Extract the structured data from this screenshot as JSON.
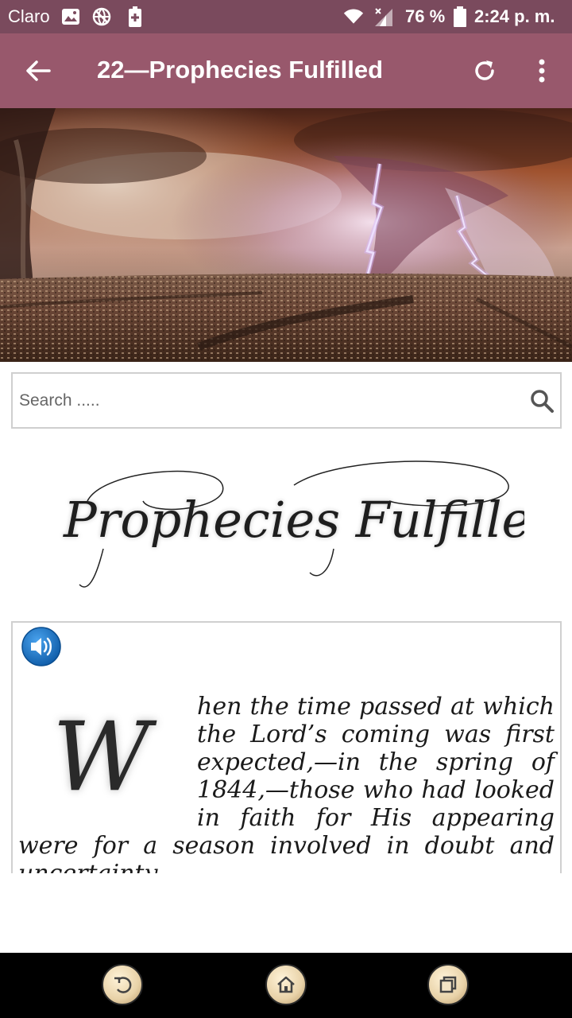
{
  "status_bar": {
    "carrier": "Claro",
    "battery_percent": "76 %",
    "time": "2:24 p. m.",
    "icons": [
      "image-icon",
      "vpn-globe-icon",
      "battery-saver-icon",
      "wifi-icon",
      "signal-icon",
      "battery-icon"
    ]
  },
  "app_bar": {
    "title": "22—Prophecies Fulfilled",
    "background": "#98586c",
    "icons": [
      "back-arrow-icon",
      "refresh-icon",
      "more-vert-icon"
    ]
  },
  "search": {
    "placeholder": "Search .....",
    "value": ""
  },
  "heading_logo": {
    "text": "Prophecies Fulfilled"
  },
  "content": {
    "audio_icon": "speaker-icon",
    "drop_cap": "W",
    "paragraph": "hen the time passed at which the Lord’s coming was first expected,—in the spring of 1844,—those who had looked in faith for His appearing were for a season involved in doubt and uncertainty."
  },
  "nav_bar": {
    "icons": [
      "back-icon",
      "home-icon",
      "recent-apps-icon"
    ]
  },
  "colors": {
    "status_bar": "#7a4a5d",
    "app_bar": "#98586c",
    "nav_bar": "#000000"
  }
}
